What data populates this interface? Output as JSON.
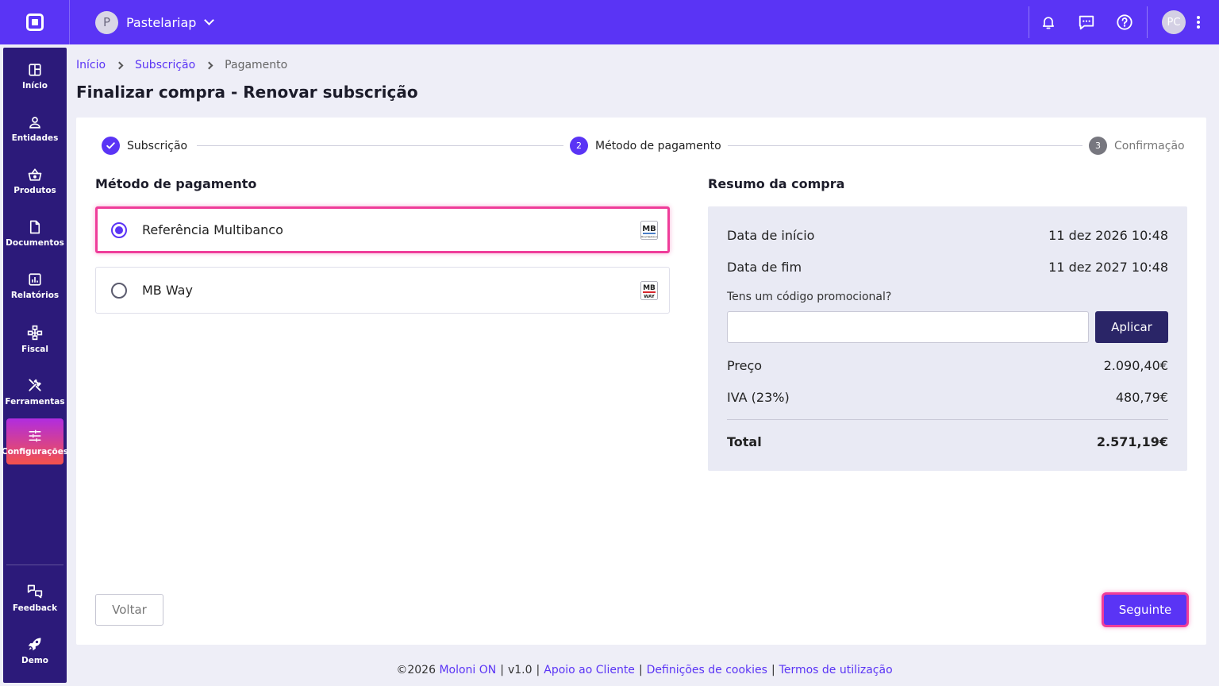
{
  "topbar": {
    "company_initial": "P",
    "company_name": "Pastelariap",
    "user_initials": "PC",
    "icons": [
      "bell-icon",
      "chat-icon",
      "help-icon",
      "kebab-menu-icon"
    ]
  },
  "sidebar": {
    "items": [
      {
        "label": "Início",
        "icon": "dashboard-icon"
      },
      {
        "label": "Entidades",
        "icon": "user-icon"
      },
      {
        "label": "Produtos",
        "icon": "basket-icon"
      },
      {
        "label": "Documentos",
        "icon": "document-icon"
      },
      {
        "label": "Relatórios",
        "icon": "chart-icon"
      },
      {
        "label": "Fiscal",
        "icon": "hierarchy-icon"
      },
      {
        "label": "Ferramentas",
        "icon": "tools-icon"
      },
      {
        "label": "Configurações",
        "icon": "sliders-icon",
        "active": true
      },
      {
        "label": "Feedback",
        "icon": "feedback-icon"
      },
      {
        "label": "Demo",
        "icon": "rocket-icon"
      }
    ]
  },
  "breadcrumb": {
    "items": [
      "Início",
      "Subscrição",
      "Pagamento"
    ]
  },
  "page": {
    "title": "Finalizar compra - Renovar subscrição"
  },
  "stepper": {
    "steps": [
      {
        "number": "1",
        "label": "Subscrição",
        "state": "done"
      },
      {
        "number": "2",
        "label": "Método de pagamento",
        "state": "current"
      },
      {
        "number": "3",
        "label": "Confirmação",
        "state": "pending"
      }
    ]
  },
  "payment": {
    "title": "Método de pagamento",
    "options": [
      {
        "label": "Referência Multibanco",
        "selected": true,
        "logo_text": "MB",
        "logo_sub": "MULTIBANCO"
      },
      {
        "label": "MB Way",
        "selected": false,
        "logo_text": "MB",
        "logo_sub": "WAY"
      }
    ]
  },
  "summary": {
    "title": "Resumo da compra",
    "start_label": "Data de início",
    "start_value": "11 dez 2026 10:48",
    "end_label": "Data de fim",
    "end_value": "11 dez 2027 10:48",
    "promo_label": "Tens um código promocional?",
    "promo_value": "",
    "apply_label": "Aplicar",
    "price_label": "Preço",
    "price_value": "2.090,40€",
    "vat_label": "IVA (23%)",
    "vat_value": "480,79€",
    "total_label": "Total",
    "total_value": "2.571,19€"
  },
  "actions": {
    "back_label": "Voltar",
    "next_label": "Seguinte"
  },
  "footer": {
    "copyright": "©2026",
    "brand": "Moloni ON",
    "version": "v1.0",
    "support": "Apoio ao Cliente",
    "cookies": "Definições de cookies",
    "terms": "Termos de utilização"
  },
  "colors": {
    "brand": "#5a34f5",
    "sidebar": "#2c1a7a",
    "highlight": "#ef3d9a",
    "apply_button": "#2a2567"
  }
}
